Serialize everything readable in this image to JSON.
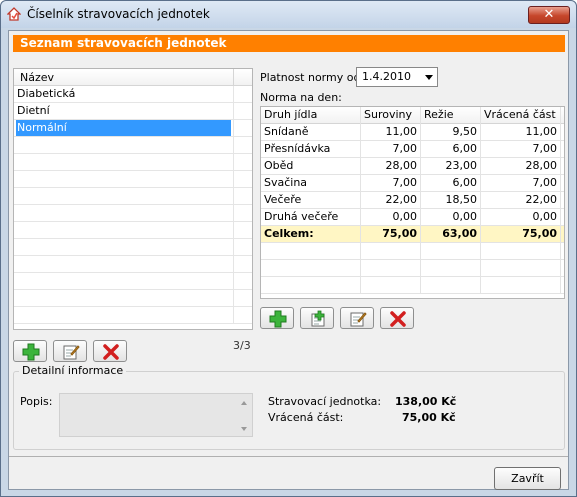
{
  "window": {
    "title": "Číselník stravovacích jednotek",
    "close_glyph": "✕"
  },
  "section_title": "Seznam stravovacích jednotek",
  "list": {
    "column_header": "Název",
    "items": [
      {
        "label": "Diabetická",
        "selected": false
      },
      {
        "label": "Dietní",
        "selected": false
      },
      {
        "label": "Normální",
        "selected": true
      }
    ],
    "count": "3/3"
  },
  "platnost": {
    "label": "Platnost normy od:",
    "value": "1.4.2010"
  },
  "norma": {
    "label": "Norma na den:",
    "columns": [
      "Druh jídla",
      "Suroviny",
      "Režie",
      "Vrácená část"
    ],
    "rows": [
      [
        "Snídaně",
        "11,00",
        "9,50",
        "11,00"
      ],
      [
        "Přesnídávka",
        "7,00",
        "6,00",
        "7,00"
      ],
      [
        "Oběd",
        "28,00",
        "23,00",
        "28,00"
      ],
      [
        "Svačina",
        "7,00",
        "6,00",
        "7,00"
      ],
      [
        "Večeře",
        "22,00",
        "18,50",
        "22,00"
      ],
      [
        "Druhá večeře",
        "0,00",
        "0,00",
        "0,00"
      ]
    ],
    "total": [
      "Celkem:",
      "75,00",
      "63,00",
      "75,00"
    ]
  },
  "detail": {
    "legend": "Detailní informace",
    "popis_label": "Popis:",
    "stravovaci_label": "Stravovací jednotka:",
    "stravovaci_value": "138,00 Kč",
    "vracena_label": "Vrácená část:",
    "vracena_value": "75,00 Kč"
  },
  "footer": {
    "close_label": "Zavřít"
  },
  "colors": {
    "accent": "#ff8000",
    "selection": "#3399ff",
    "total_row": "#fff6c4"
  }
}
